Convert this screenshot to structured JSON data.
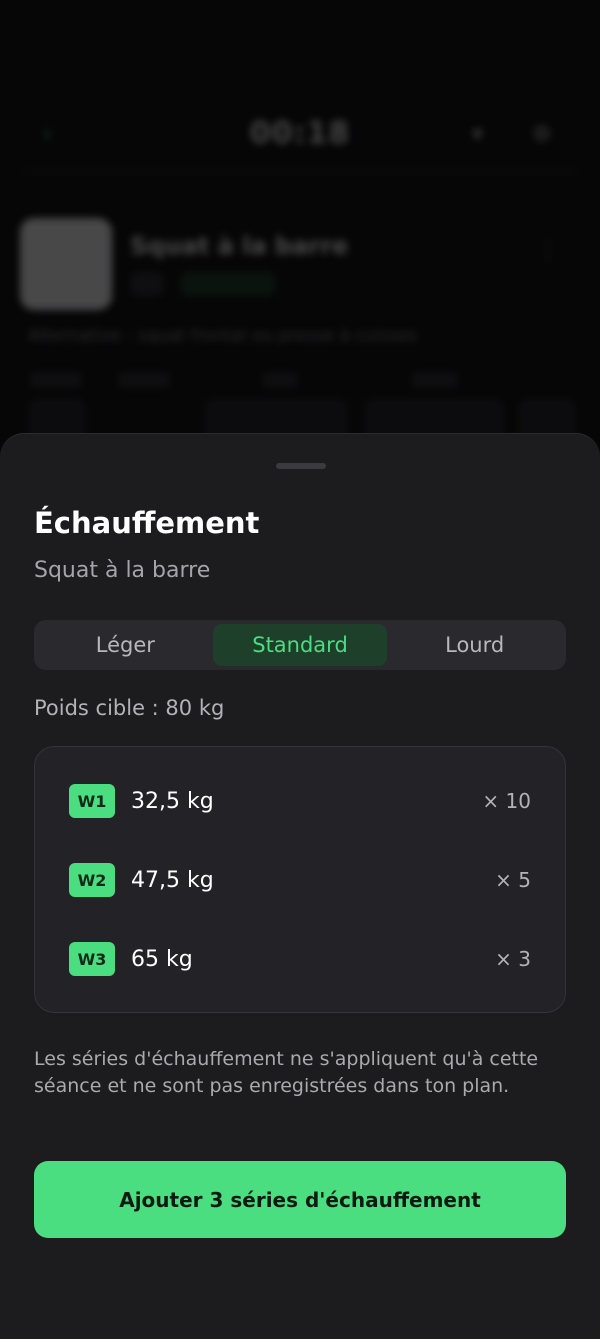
{
  "background": {
    "timer": "00:18",
    "exercise_title": "Squat à la barre",
    "description": "Alternative : squat frontal ou presse à cuisses"
  },
  "sheet": {
    "title": "Échauffement",
    "subtitle": "Squat à la barre",
    "intensity_options": [
      {
        "label": "Léger",
        "selected": false
      },
      {
        "label": "Standard",
        "selected": true
      },
      {
        "label": "Lourd",
        "selected": false
      }
    ],
    "target_weight": "Poids cible : 80 kg",
    "warmup_sets": [
      {
        "badge": "W1",
        "weight": "32,5 kg",
        "reps": "× 10"
      },
      {
        "badge": "W2",
        "weight": "47,5 kg",
        "reps": "× 5"
      },
      {
        "badge": "W3",
        "weight": "65 kg",
        "reps": "× 3"
      }
    ],
    "note": "Les séries d'échauffement ne s'appliquent qu'à cette séance et ne sont pas enregistrées dans ton plan.",
    "cta_label": "Ajouter 3 séries d'échauffement"
  },
  "colors": {
    "accent": "#4ade80",
    "sheet_background": "#1c1c1f",
    "card_background": "#232327"
  }
}
